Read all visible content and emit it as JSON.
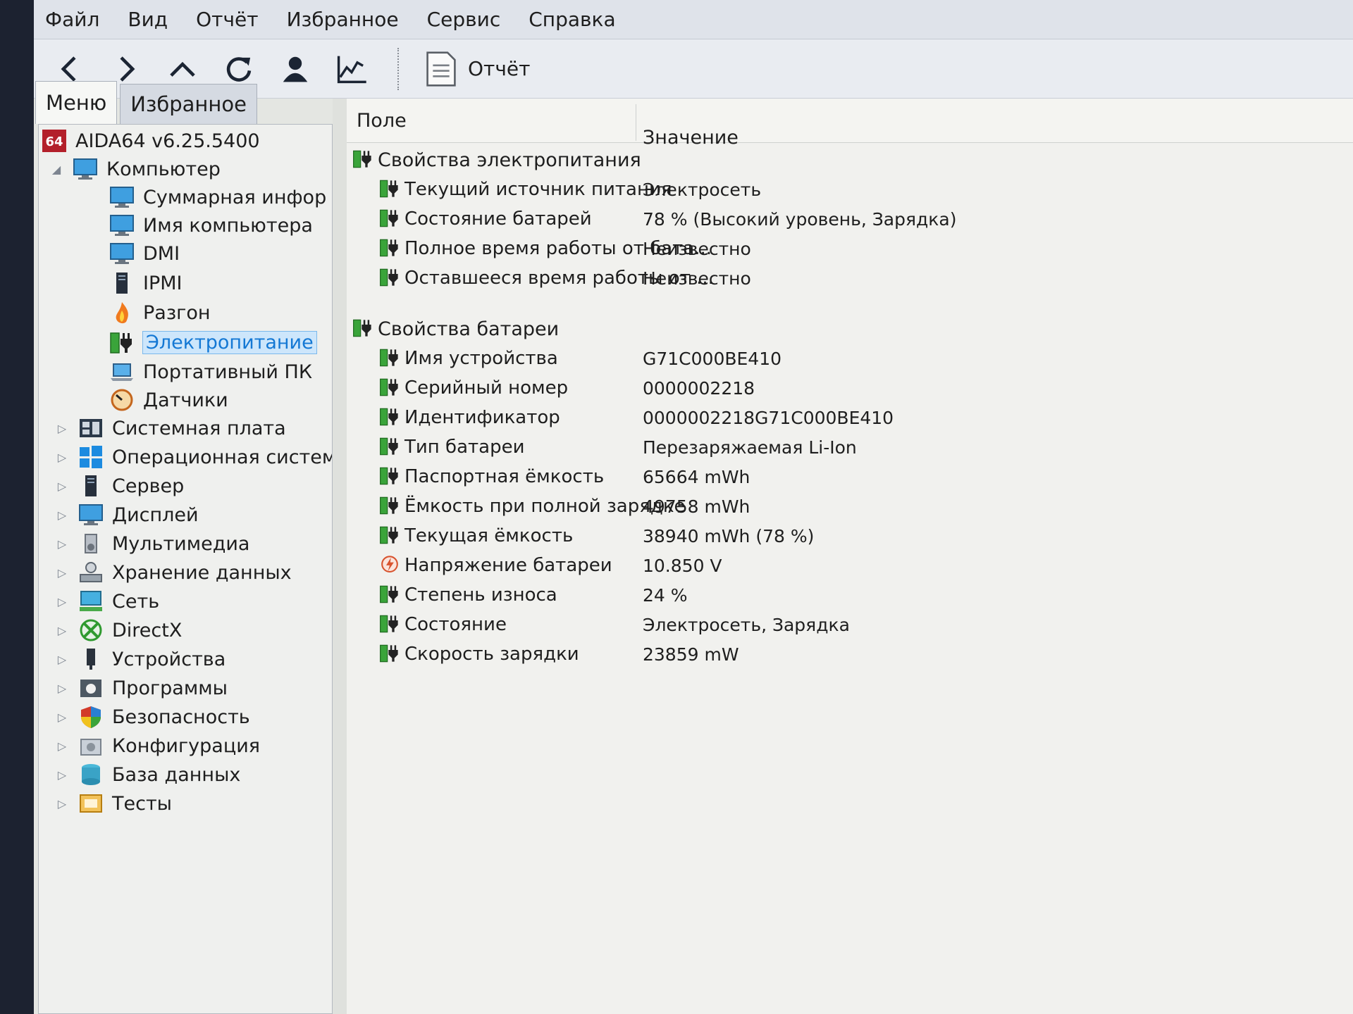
{
  "menu": [
    "Файл",
    "Вид",
    "Отчёт",
    "Избранное",
    "Сервис",
    "Справка"
  ],
  "toolbar": {
    "buttons": [
      "back-icon",
      "forward-icon",
      "up-icon",
      "refresh-icon",
      "user-icon",
      "chart-icon"
    ],
    "report_label": "Отчёт"
  },
  "tabs": [
    "Меню",
    "Избранное"
  ],
  "tree": {
    "root": "AIDA64 v6.25.5400",
    "computer": "Компьютер",
    "computer_children": [
      "Суммарная инфор",
      "Имя компьютера",
      "DMI",
      "IPMI",
      "Разгон",
      "Электропитание",
      "Портативный ПК",
      "Датчики"
    ],
    "sections": [
      "Системная плата",
      "Операционная систем",
      "Сервер",
      "Дисплей",
      "Мультимедиа",
      "Хранение данных",
      "Сеть",
      "DirectX",
      "Устройства",
      "Программы",
      "Безопасность",
      "Конфигурация",
      "База данных",
      "Тесты"
    ]
  },
  "grid": {
    "col_field": "Поле",
    "col_value": "Значение",
    "groups": [
      {
        "title": "Свойства электропитания",
        "rows": [
          {
            "field": "Текущий источник питания",
            "value": "Электросеть"
          },
          {
            "field": "Состояние батарей",
            "value": "78 % (Высокий уровень, Зарядка)"
          },
          {
            "field": "Полное время работы от бата...",
            "value": "Неизвестно"
          },
          {
            "field": "Оставшееся время работы от ...",
            "value": "Неизвестно"
          }
        ]
      },
      {
        "title": "Свойства батареи",
        "rows": [
          {
            "field": "Имя устройства",
            "value": "G71C000BE410"
          },
          {
            "field": "Серийный номер",
            "value": "0000002218"
          },
          {
            "field": "Идентификатор",
            "value": "0000002218G71C000BE410"
          },
          {
            "field": "Тип батареи",
            "value": "Перезаряжаемая Li-Ion"
          },
          {
            "field": "Паспортная ёмкость",
            "value": "65664 mWh"
          },
          {
            "field": "Ёмкость при полной зарядке",
            "value": "49758 mWh"
          },
          {
            "field": "Текущая ёмкость",
            "value": "38940 mWh  (78 %)"
          },
          {
            "field": "Напряжение батареи",
            "value": "10.850 V"
          },
          {
            "field": "Степень износа",
            "value": "24 %"
          },
          {
            "field": "Состояние",
            "value": "Электросеть, Зарядка"
          },
          {
            "field": "Скорость зарядки",
            "value": "23859 mW"
          }
        ]
      }
    ]
  },
  "colors": {
    "selection_text": "#1478d4",
    "battery_green": "#3aa43a",
    "window_bg": "#e4e6e2"
  }
}
